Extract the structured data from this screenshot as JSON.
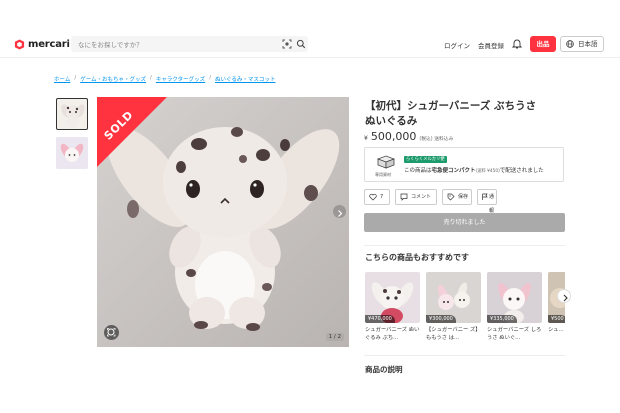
{
  "header": {
    "logo_text": "mercari",
    "search_placeholder": "なにをお探しですか？",
    "login": "ログイン",
    "signup": "会員登録",
    "listing_button": "出品",
    "language": "日本語"
  },
  "breadcrumb": [
    "ホーム",
    "ゲーム・おもちゃ・グッズ",
    "キャラクターグッズ",
    "ぬいぐるみ・マスコット"
  ],
  "item": {
    "sold_label": "SOLD",
    "pager": "1 / 2",
    "title": "【初代】シュガーバニーズ ぶちうさ ぬいぐるみ",
    "currency": "¥",
    "price": "500,000",
    "price_note": "(税込) 送料込み",
    "shipping": {
      "box_caption": "専用資材",
      "badge": "らくらくメルカリ便",
      "text_prefix": "この商品は",
      "method": "宅急便コンパクト",
      "fee": "(送料 ¥450)",
      "text_suffix": "で配送されました"
    },
    "like_count": "7",
    "comment_label": "コメント",
    "save_label": "保存",
    "report_label": "通報",
    "sold_out_button": "売り切れました"
  },
  "recommendations": {
    "title": "こちらの商品もおすすめです",
    "items": [
      {
        "price": "¥470,000",
        "name": "シュガーバニーズ ぬいぐるみ ぶち..."
      },
      {
        "price": "¥300,000",
        "name": "【シュガーバニー ズ】ももうさ は..."
      },
      {
        "price": "¥335,000",
        "name": "シュガーバニーズ しろうさ ぬいぐ..."
      },
      {
        "price": "¥500",
        "name": "シュ..."
      }
    ]
  },
  "description_title": "商品の説明",
  "colors": {
    "accent": "#ff333f",
    "link": "#0095ee",
    "sold_ribbon": "#ff333f",
    "badge": "#1e9b6d"
  }
}
